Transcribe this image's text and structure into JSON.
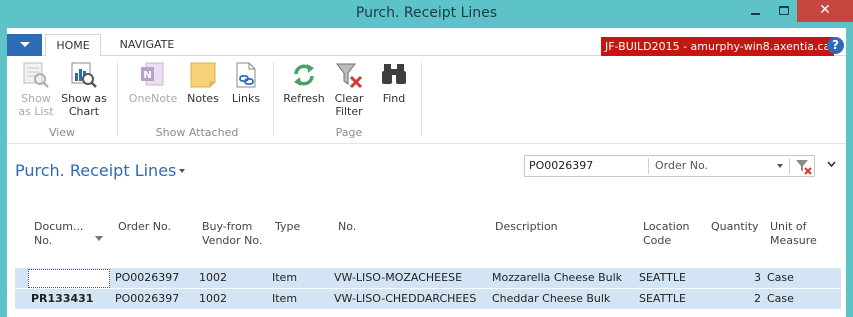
{
  "window": {
    "title": "Purch. Receipt Lines"
  },
  "ribbon_tabs": [
    "HOME",
    "NAVIGATE"
  ],
  "server_badge": "JF-BUILD2015 - amurphy-win8.axentia.ca",
  "ribbon": {
    "view": {
      "label": "View",
      "buttons": [
        {
          "label1": "Show",
          "label2": "as List",
          "icon": "list-icon",
          "enabled": false
        },
        {
          "label1": "Show as",
          "label2": "Chart",
          "icon": "chart-icon",
          "enabled": true
        }
      ]
    },
    "show_attached": {
      "label": "Show Attached",
      "buttons": [
        {
          "label1": "OneNote",
          "label2": "",
          "icon": "onenote-icon",
          "enabled": false
        },
        {
          "label1": "Notes",
          "label2": "",
          "icon": "notes-icon",
          "enabled": true
        },
        {
          "label1": "Links",
          "label2": "",
          "icon": "links-icon",
          "enabled": true
        }
      ]
    },
    "page": {
      "label": "Page",
      "buttons": [
        {
          "label1": "Refresh",
          "label2": "",
          "icon": "refresh-icon",
          "enabled": true
        },
        {
          "label1": "Clear",
          "label2": "Filter",
          "icon": "clear-filter-icon",
          "enabled": true
        },
        {
          "label1": "Find",
          "label2": "",
          "icon": "binoculars-icon",
          "enabled": true
        }
      ]
    }
  },
  "page": {
    "title": "Purch. Receipt Lines"
  },
  "search": {
    "value": "PO0026397",
    "field": "Order No."
  },
  "table": {
    "headers": [
      {
        "l1": "Docum...",
        "l2": "No."
      },
      {
        "l1": "Order No.",
        "l2": ""
      },
      {
        "l1": "Buy-from",
        "l2": "Vendor No."
      },
      {
        "l1": "Type",
        "l2": ""
      },
      {
        "l1": "No.",
        "l2": ""
      },
      {
        "l1": "Description",
        "l2": ""
      },
      {
        "l1": "Location",
        "l2": "Code"
      },
      {
        "l1": "Quantity",
        "l2": ""
      },
      {
        "l1": "Unit of",
        "l2": "Measure"
      }
    ],
    "rows": [
      {
        "doc_no": "",
        "order_no": "PO0026397",
        "vendor_no": "1002",
        "type": "Item",
        "no": "VW-LISO-MOZACHEESE",
        "description": "Mozzarella Cheese Bulk",
        "location": "SEATTLE",
        "quantity": "3",
        "uom": "Case"
      },
      {
        "doc_no": "PR133431",
        "order_no": "PO0026397",
        "vendor_no": "1002",
        "type": "Item",
        "no": "VW-LISO-CHEDDARCHEES",
        "description": "Cheddar Cheese Bulk",
        "location": "SEATTLE",
        "quantity": "2",
        "uom": "Case"
      }
    ]
  },
  "colors": {
    "accent": "#2d6cb5",
    "titlebar": "#5ec2c9",
    "close": "#c7463f",
    "badge": "#c4170f",
    "row_selected": "#d3e5f5"
  }
}
